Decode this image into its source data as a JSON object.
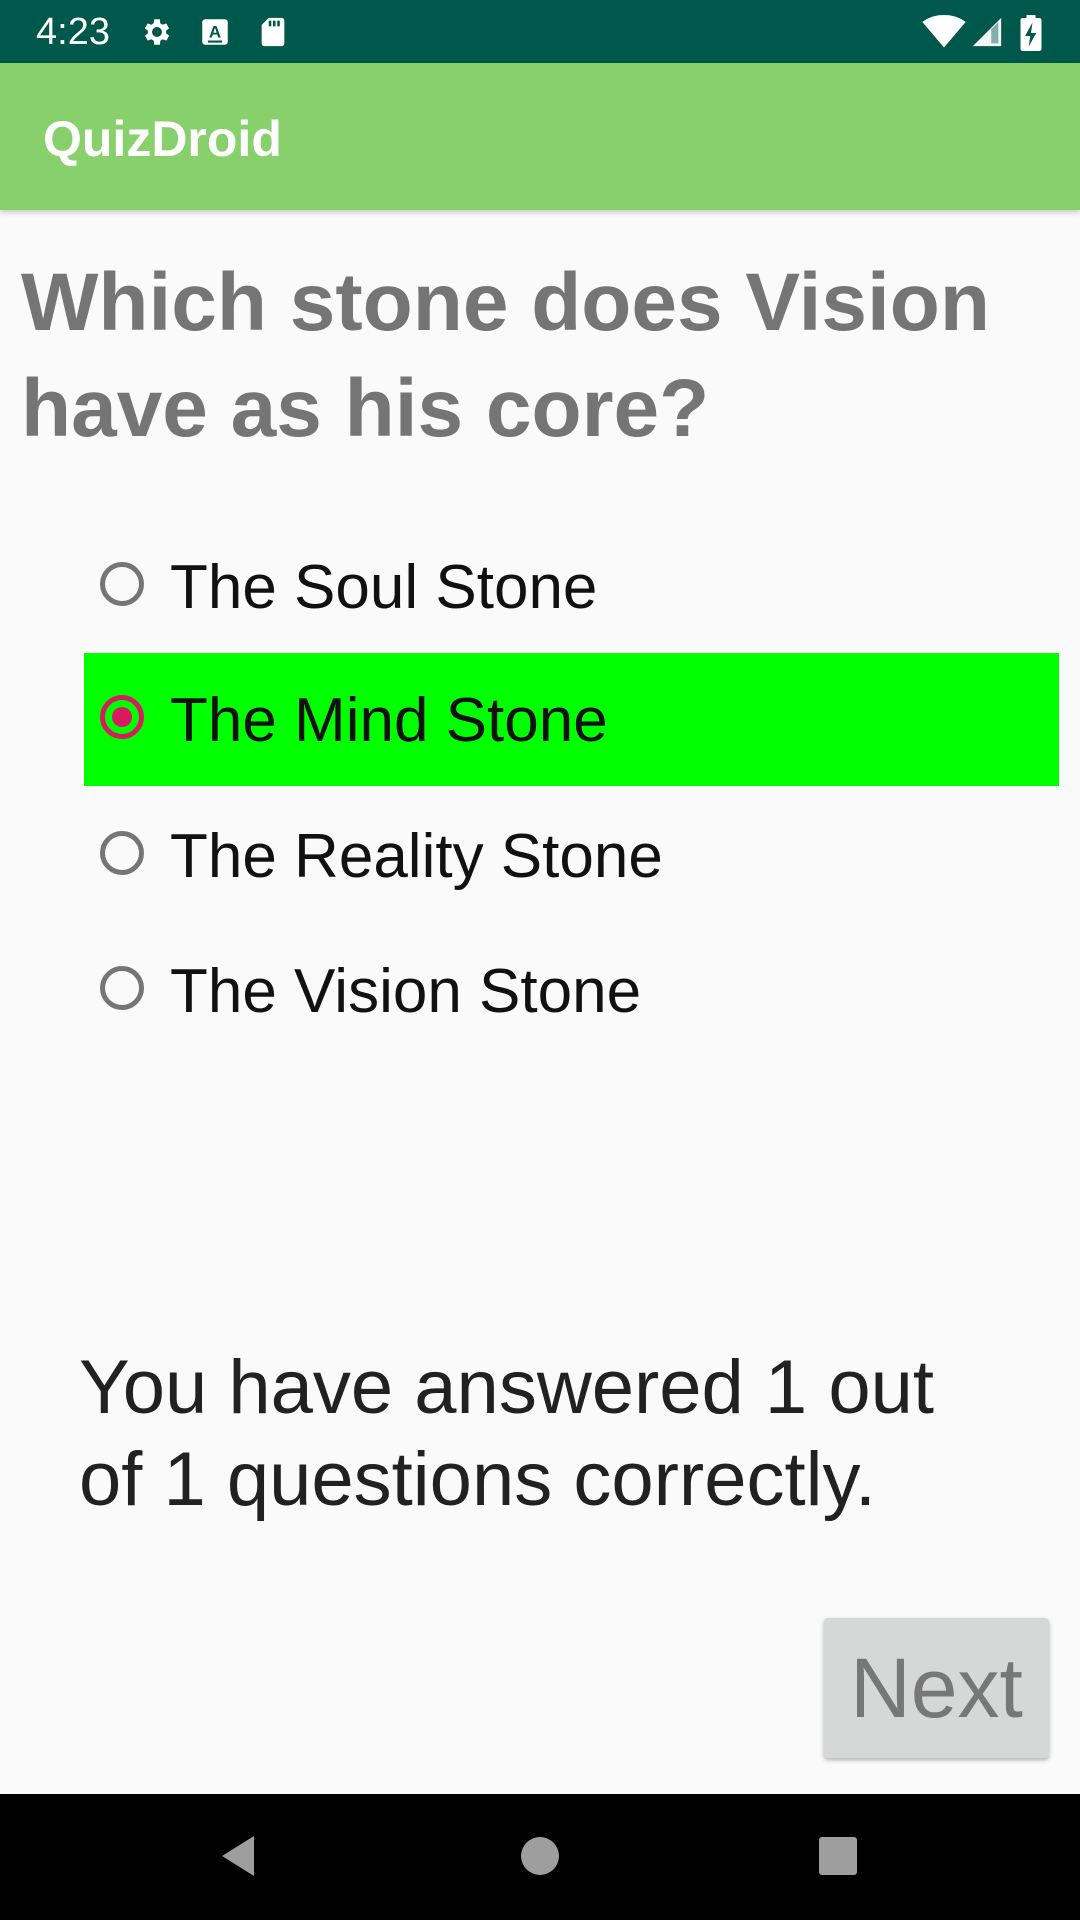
{
  "status_bar": {
    "time": "4:23",
    "left_icons": [
      "gear-icon",
      "accessibility-a-icon",
      "sd-card-icon"
    ],
    "right_icons": [
      "wifi-icon",
      "cell-signal-icon",
      "battery-charging-icon"
    ]
  },
  "app_bar": {
    "title": "QuizDroid"
  },
  "question": {
    "text": "Which stone does Vision have as his core?"
  },
  "options": [
    {
      "label": "The Soul Stone",
      "checked": false,
      "highlighted": false
    },
    {
      "label": "The Mind Stone",
      "checked": true,
      "highlighted": true
    },
    {
      "label": "The Reality Stone",
      "checked": false,
      "highlighted": false
    },
    {
      "label": "The Vision Stone",
      "checked": false,
      "highlighted": false
    }
  ],
  "score": {
    "text": "You have answered 1 out of 1 questions correctly."
  },
  "next_button": {
    "label": "Next",
    "enabled": false
  },
  "nav_bar": {
    "buttons": [
      "back-icon",
      "home-icon",
      "recents-icon"
    ]
  },
  "colors": {
    "status_bar": "#00574b",
    "app_bar": "#88d06b",
    "correct_highlight": "#00ff00",
    "radio_accent": "#d81b60",
    "question_text": "#757575"
  }
}
